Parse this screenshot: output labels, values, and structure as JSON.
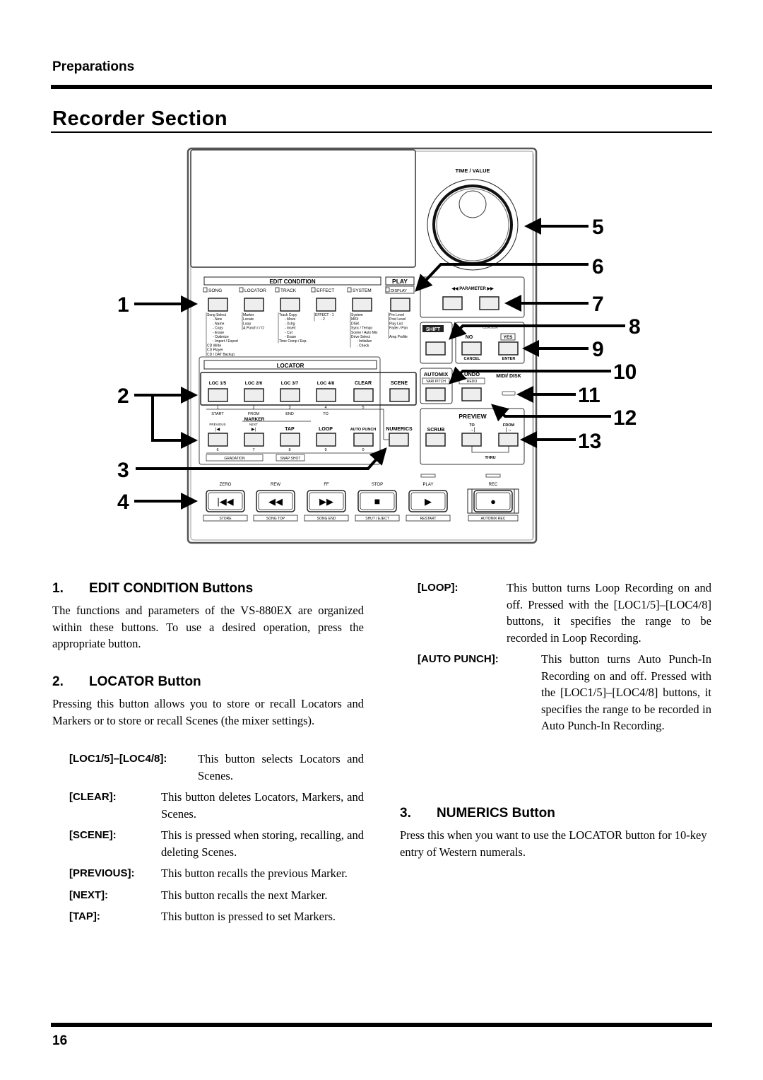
{
  "header": {
    "running_head": "Preparations",
    "page_title": "Recorder Section"
  },
  "diagram": {
    "callouts": [
      "1",
      "2",
      "3",
      "4",
      "5",
      "6",
      "7",
      "8",
      "9",
      "10",
      "11",
      "12",
      "13"
    ],
    "time_value_label": "TIME / VALUE",
    "edit_condition": {
      "group_label": "EDIT CONDITION",
      "play_label": "PLAY",
      "buttons": [
        {
          "label": "SONG",
          "items": [
            "Song Select",
            "- New",
            "- Name",
            "- Copy",
            "- Erase",
            "- Optimize",
            "- Import / Export",
            "CD Write",
            "CD Player",
            "CD / DAT Backup"
          ]
        },
        {
          "label": "LOCATOR",
          "items": [
            "Marker",
            "Locate",
            "Loop",
            "A.Punch I / O"
          ]
        },
        {
          "label": "TRACK",
          "items": [
            "Track Copy",
            "- Move",
            "- Xchg",
            "- Insert",
            "- Cut",
            "- Erase",
            "Time Comp / Exp."
          ]
        },
        {
          "label": "EFFECT",
          "items": [
            "EFFECT - 1",
            "- 2"
          ]
        },
        {
          "label": "SYSTEM",
          "items": [
            "System",
            "MIDI",
            "DISK",
            "Sync / Tempo",
            "Scene / Auto Mix",
            "Drive Select",
            "- Initialize",
            "- Check"
          ]
        },
        {
          "label": "DISPLAY",
          "items": [
            "Pre Level",
            "Post Level",
            "Play List",
            "Fader / Pan",
            "",
            "Amp Profile"
          ]
        }
      ]
    },
    "parameter_label": "PARAMETER",
    "shift_label": "SHIFT",
    "cursor_label": "CURSOR",
    "no_label": "NO",
    "yes_label": "YES",
    "cancel_label": "CANCEL",
    "enter_label": "ENTER",
    "automix_label": "AUTOMIX",
    "vari_pitch_label": "VARI PITCH",
    "undo_label": "UNDO",
    "redo_label": "REDO",
    "midi_disk_label": "MIDI/ DISK",
    "locator": {
      "group_label": "LOCATOR",
      "top_buttons": [
        "LOC 1/5",
        "LOC 2/6",
        "LOC 3/7",
        "LOC 4/8",
        "CLEAR",
        "SCENE"
      ],
      "top_numbers": [
        "1",
        "2",
        "3",
        "4",
        "5"
      ],
      "top_sublabels": [
        "START",
        "FROM",
        "END",
        "TO"
      ],
      "marker_label": "MARKER",
      "bottom_buttons": [
        "PREVIOUS",
        "NEXT",
        "TAP",
        "LOOP",
        "AUTO PUNCH"
      ],
      "bottom_numbers": [
        "6",
        "7",
        "8",
        "9",
        "0"
      ],
      "gradation_label": "GRADATION",
      "snapshot_label": "SNAP SHOT",
      "numerics_label": "NUMERICS"
    },
    "preview": {
      "group_label": "PREVIEW",
      "scrub_label": "SCRUB",
      "to_label": "TO",
      "from_label": "FROM",
      "thru_label": "THRU"
    },
    "transport": [
      {
        "label": "ZERO",
        "sub": "STORE",
        "icon": "zero-icon"
      },
      {
        "label": "REW",
        "sub": "SONG TOP",
        "icon": "rewind-icon"
      },
      {
        "label": "FF",
        "sub": "SONG END",
        "icon": "fast-forward-icon"
      },
      {
        "label": "STOP",
        "sub": "SHUT / EJECT",
        "icon": "stop-icon"
      },
      {
        "label": "PLAY",
        "sub": "RESTART",
        "icon": "play-icon"
      },
      {
        "label": "REC",
        "sub": "AUTOMIX REC",
        "icon": "record-icon"
      }
    ]
  },
  "sections": {
    "s1": {
      "num": "1.",
      "title": "EDIT CONDITION Buttons",
      "body": "The functions and parameters of the VS-880EX are organized within these buttons. To use a desired operation, press the appropriate button."
    },
    "s2": {
      "num": "2.",
      "title": "LOCATOR Button",
      "body": "Pressing this button allows you to store or recall Locators and Markers or to store or recall Scenes (the mixer settings).",
      "defs": [
        {
          "term": "[LOC1/5]–[LOC4/8]:",
          "desc": "This button selects Locators and Scenes."
        },
        {
          "term": "[CLEAR]:",
          "desc": "This button deletes Locators, Markers, and Scenes."
        },
        {
          "term": "[SCENE]:",
          "desc": "This is pressed when storing, recalling, and deleting Scenes."
        },
        {
          "term": "[PREVIOUS]:",
          "desc": "This button recalls the previous Marker."
        },
        {
          "term": "[NEXT]:",
          "desc": "This button recalls the next Marker."
        },
        {
          "term": "[TAP]:",
          "desc": "This button is pressed to set Markers."
        },
        {
          "term": "[LOOP]:",
          "desc": "This button turns Loop Recording on and off. Pressed with the [LOC1/5]–[LOC4/8] buttons, it specifies the range to be recorded in Loop Recording."
        },
        {
          "term": "[AUTO PUNCH]:",
          "desc": "This button turns Auto Punch-In Recording on and off. Pressed with the [LOC1/5]–[LOC4/8] buttons, it specifies the range to be recorded in Auto Punch-In Recording."
        }
      ]
    },
    "s3": {
      "num": "3.",
      "title": "NUMERICS Button",
      "body": "Press this when you want to use the LOCATOR button for 10-key entry of Western numerals."
    }
  },
  "footer": {
    "page_number": "16"
  }
}
